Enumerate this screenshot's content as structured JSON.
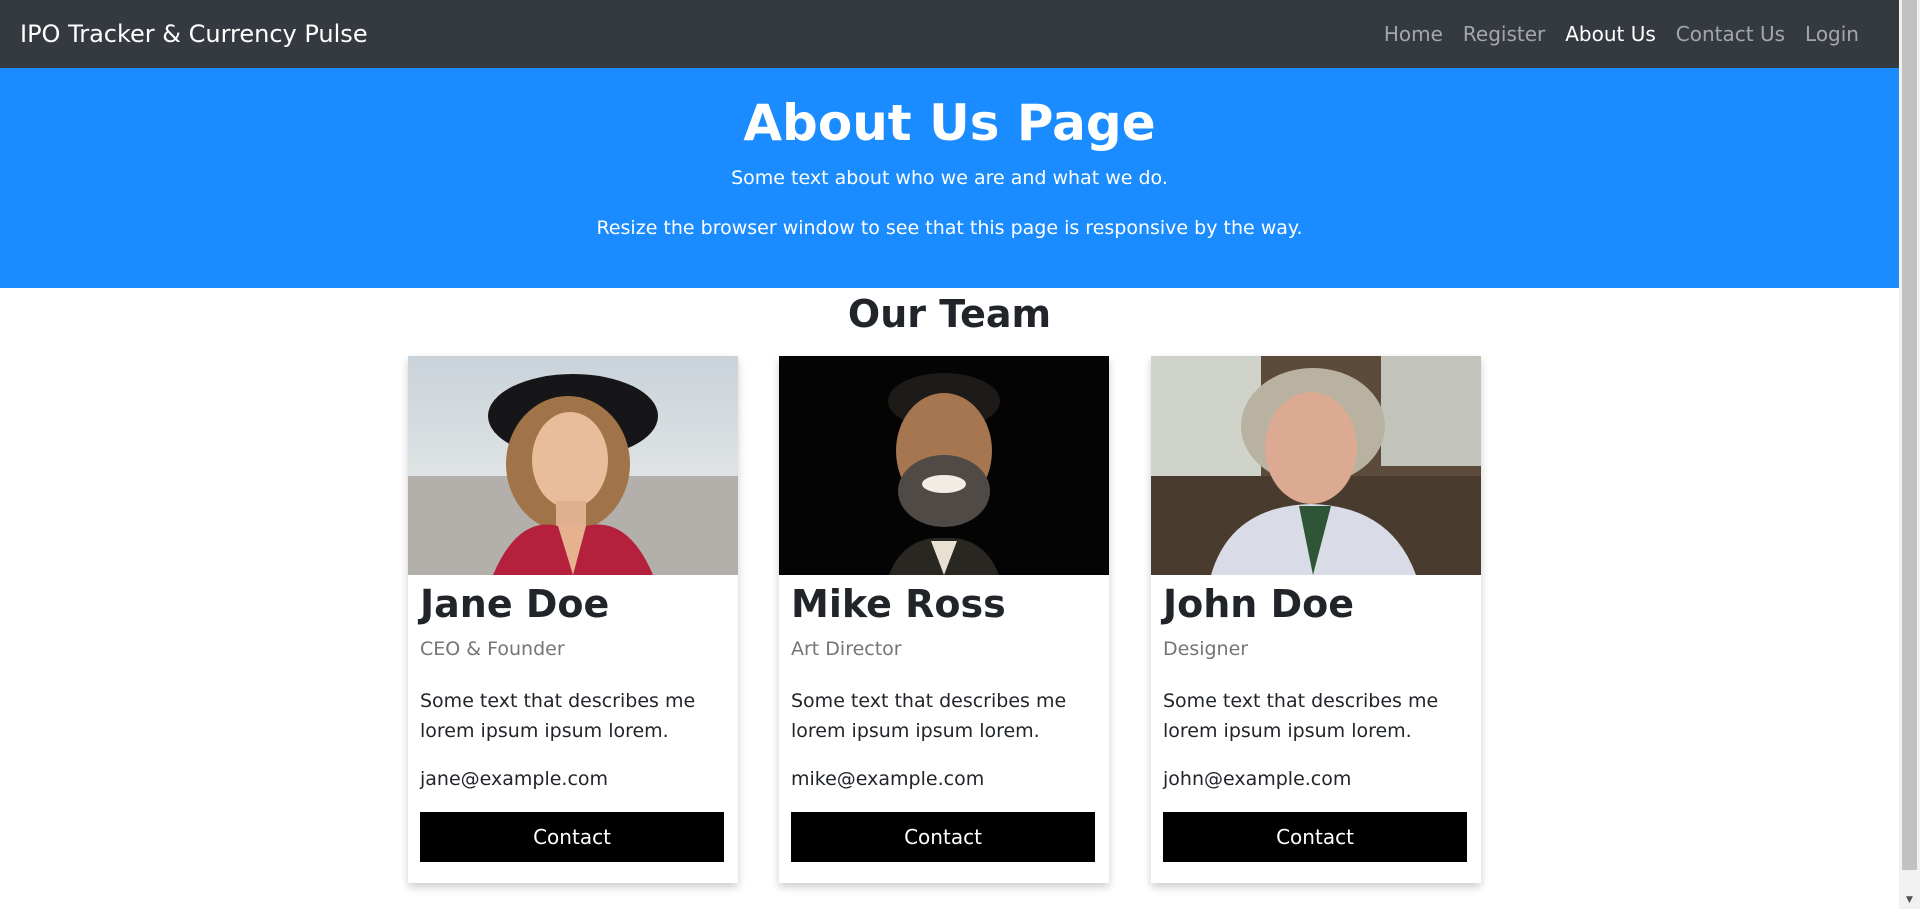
{
  "navbar": {
    "brand": "IPO Tracker & Currency Pulse",
    "links": [
      {
        "label": "Home",
        "active": false
      },
      {
        "label": "Register",
        "active": false
      },
      {
        "label": "About Us",
        "active": true
      },
      {
        "label": "Contact Us",
        "active": false
      },
      {
        "label": "Login",
        "active": false
      }
    ]
  },
  "hero": {
    "title": "About Us Page",
    "subtitle": "Some text about who we are and what we do.",
    "note": "Resize the browser window to see that this page is responsive by the way."
  },
  "team": {
    "title": "Our Team",
    "members": [
      {
        "name": "Jane Doe",
        "role": "CEO & Founder",
        "description": "Some text that describes me lorem ipsum ipsum lorem.",
        "email": "jane@example.com",
        "button": "Contact"
      },
      {
        "name": "Mike Ross",
        "role": "Art Director",
        "description": "Some text that describes me lorem ipsum ipsum lorem.",
        "email": "mike@example.com",
        "button": "Contact"
      },
      {
        "name": "John Doe",
        "role": "Designer",
        "description": "Some text that describes me lorem ipsum ipsum lorem.",
        "email": "john@example.com",
        "button": "Contact"
      }
    ]
  },
  "colors": {
    "navbar_bg": "#343a40",
    "hero_bg": "#1a8cff",
    "button_bg": "#000000"
  }
}
